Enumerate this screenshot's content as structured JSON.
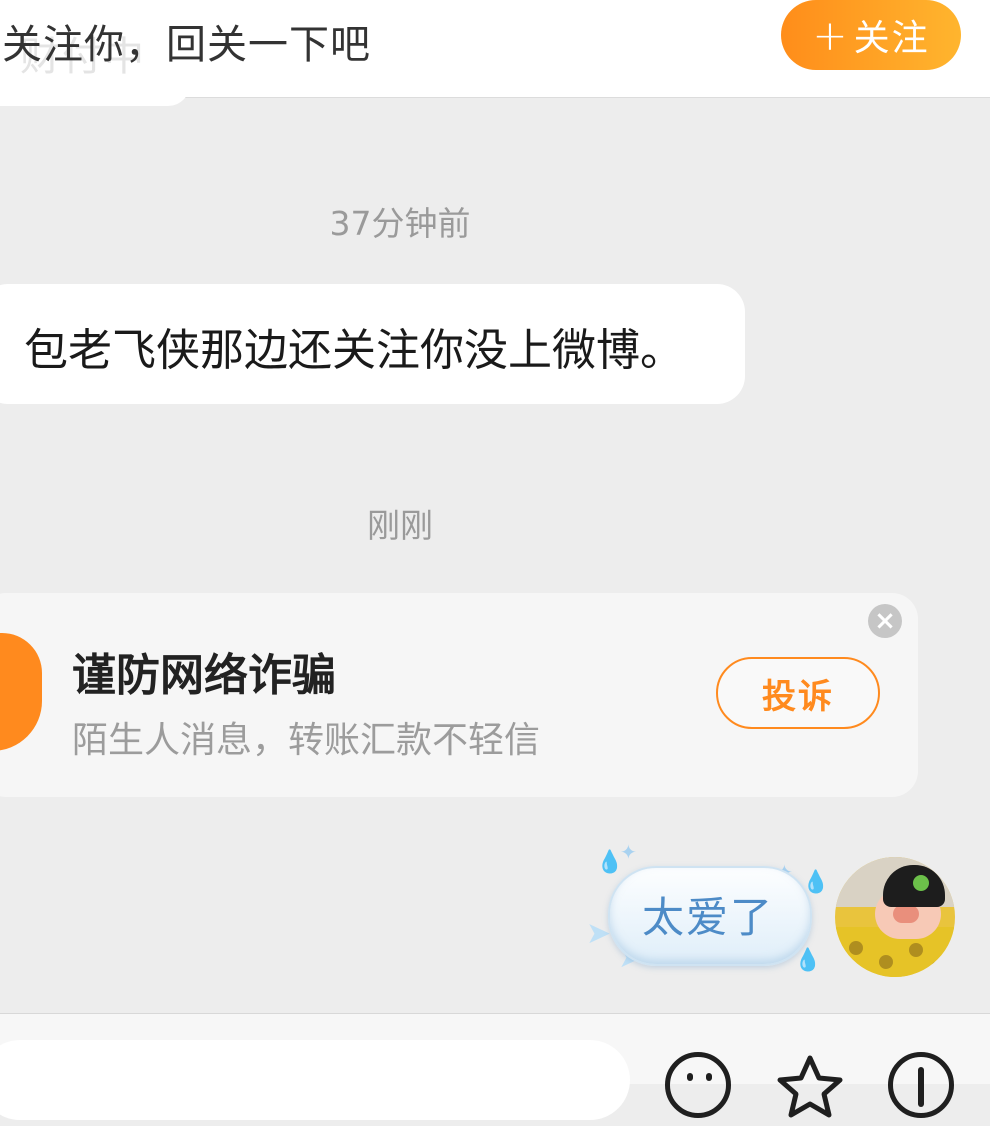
{
  "banner": {
    "text": "关注你，回关一下吧",
    "ghost_text": "财付中",
    "follow_label": "关注",
    "follow_plus": "+"
  },
  "messages": {
    "timestamp_1": "37分钟前",
    "incoming_text": "包老飞侠那边还关注你没上微博。",
    "timestamp_2": "刚刚"
  },
  "warning": {
    "title": "谨防网络诈骗",
    "subtitle": "陌生人消息，转账汇款不轻信",
    "report_label": "投诉",
    "close_glyph": "×"
  },
  "outgoing": {
    "sticker_text": "太爱了"
  },
  "colors": {
    "accent_orange": "#ff8a1e",
    "follow_gradient_start": "#ff8d1a",
    "follow_gradient_end": "#ffb52e",
    "sticker_text": "#4d8bc7",
    "background": "#ededed"
  },
  "icons": {
    "input_bar": [
      "emoji-icon",
      "star-icon",
      "plus-icon"
    ],
    "warning": "shield-icon",
    "close": "close-icon"
  }
}
